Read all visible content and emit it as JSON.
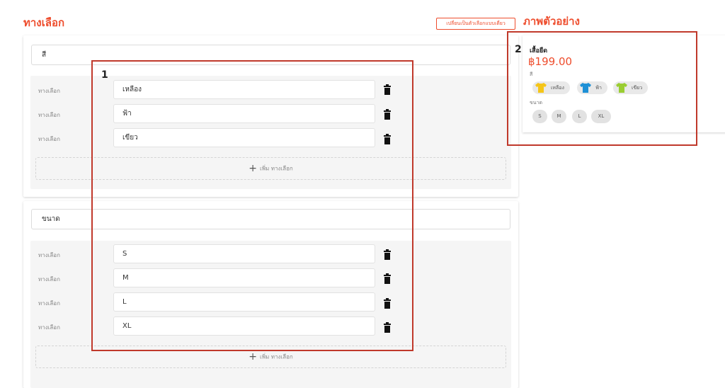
{
  "header": {
    "section_title": "ทางเลือก",
    "switch_button": "เปลี่ยนเป็นตัวเลือกแบบเดี่ยว",
    "preview_title": "ภาพตัวอย่าง"
  },
  "groups": [
    {
      "name": "สี",
      "option_label": "ทางเลือก",
      "options": [
        "เหลือง",
        "ฟ้า",
        "เขียว"
      ],
      "add_label": "เพิ่ม ทางเลือก"
    },
    {
      "name": "ขนาด",
      "option_label": "ทางเลือก",
      "options": [
        "S",
        "M",
        "L",
        "XL"
      ],
      "add_label": "เพิ่ม ทางเลือก"
    }
  ],
  "preview": {
    "product_name": "เสื้อยืด",
    "price": "฿199.00",
    "color_label": "สี",
    "colors": [
      {
        "name": "เหลือง",
        "color": "#f5c518"
      },
      {
        "name": "ฟ้า",
        "color": "#1e90d6"
      },
      {
        "name": "เขียว",
        "color": "#9acd32"
      }
    ],
    "size_label": "ขนาด",
    "sizes": [
      "S",
      "M",
      "L",
      "XL"
    ]
  },
  "annotations": {
    "box1": "1",
    "box2": "2"
  },
  "icons": {
    "trash": "trash-icon",
    "plus": "plus-icon",
    "shirt": "tshirt-icon"
  },
  "colors": {
    "accent": "#ee4d2d",
    "highlight": "#c0392b"
  }
}
